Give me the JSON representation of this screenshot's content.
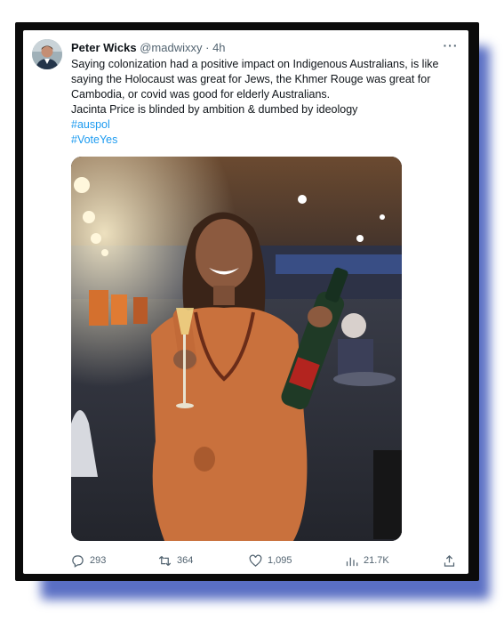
{
  "tweet": {
    "author": {
      "name": "Peter Wicks",
      "handle": "@madwixxy",
      "separator": "·",
      "time": "4h"
    },
    "more_label": "···",
    "text_lines": [
      "Saying colonization had a positive impact on Indigenous Australians, is like",
      "saying the Holocaust was great for Jews, the Khmer Rouge was great for",
      "Cambodia, or covid was good for elderly Australians.",
      "Jacinta Price is blinded by ambition & dumbed by ideology"
    ],
    "hashtags": [
      "#auspol",
      "#VoteYes"
    ],
    "actions": {
      "replies": "293",
      "retweets": "364",
      "likes": "1,095",
      "views": "21.7K"
    }
  },
  "colors": {
    "link": "#1d9bf0",
    "text": "#0f1419",
    "muted": "#536471",
    "frame": "#0b0b0b",
    "shadow": "#5a6fc4"
  },
  "icons": [
    "reply-icon",
    "retweet-icon",
    "like-icon",
    "views-icon",
    "share-icon",
    "more-icon"
  ]
}
